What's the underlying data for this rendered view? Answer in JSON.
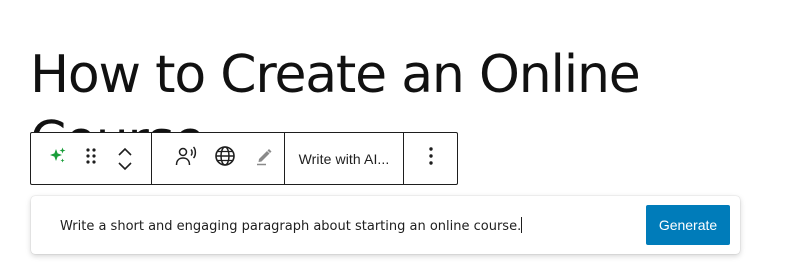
{
  "post": {
    "title": "How to Create an Online Course"
  },
  "toolbar": {
    "icons": {
      "ai": "sparkles-icon",
      "drag": "drag-handle-icon",
      "move_up": "chevron-up-icon",
      "move_down": "chevron-down-icon",
      "voice": "voice-speaker-icon",
      "language": "globe-icon",
      "edit": "pencil-icon",
      "more": "more-vertical-icon"
    },
    "write_with_ai_label": "Write with AI...",
    "accent_color": "#1a9e3a"
  },
  "prompt": {
    "value": "Write a short and engaging paragraph about starting an online course.",
    "generate_label": "Generate",
    "button_color": "#007cba"
  }
}
